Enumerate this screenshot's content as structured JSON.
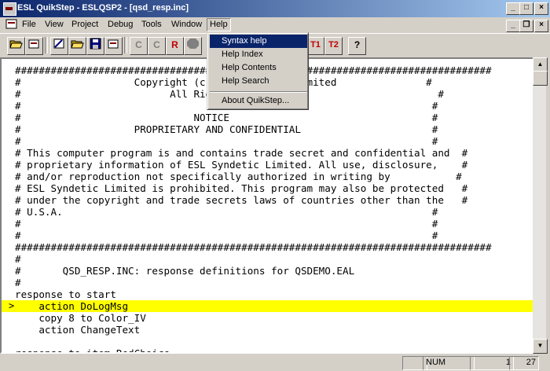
{
  "window": {
    "title": "ESL QuikStep - ESLQSP2 - [qsd_resp.inc]"
  },
  "caption_buttons": {
    "minimize": "_",
    "maximize": "□",
    "close": "×"
  },
  "mdi_buttons": {
    "minimize": "_",
    "restore": "❐",
    "close": "×"
  },
  "menu": [
    "File",
    "View",
    "Project",
    "Debug",
    "Tools",
    "Window",
    "Help"
  ],
  "help_menu": {
    "items": [
      "Syntax help",
      "Help Index",
      "Help Contents",
      "Help Search"
    ],
    "about": "About QuikStep...",
    "selected": "Syntax help"
  },
  "toolbar": {
    "c_label": "C",
    "cr_label": "C",
    "r_label": "R",
    "t1_label": "T1",
    "t2_label": "T2",
    "query_label": "?"
  },
  "editor": {
    "lines": [
      "################################################################################",
      "#                   Copyright (c) ESL Syndetic Limited               #",
      "#                         All Rights Reserved                          #",
      "#                                                                     #",
      "#                             NOTICE                                  #",
      "#                   PROPRIETARY AND CONFIDENTIAL                      #",
      "#                                                                     #",
      "# This computer program is and contains trade secret and confidential and  #",
      "# proprietary information of ESL Syndetic Limited. All use, disclosure,    #",
      "# and/or reproduction not specifically authorized in writing by           #",
      "# ESL Syndetic Limited is prohibited. This program may also be protected   #",
      "# under the copyright and trade secrets laws of countries other than the   #",
      "# U.S.A.                                                              #",
      "#                                                                     #",
      "#                                                                     #",
      "################################################################################",
      "#",
      "#       QSD_RESP.INC: response definitions for QSDEMO.EAL",
      "#",
      "response to start",
      "    action DoLogMsg",
      "    copy 8 to Color_IV",
      "    action ChangeText",
      "",
      "response to item RedChoice"
    ],
    "highlighted_line": 20,
    "marker": ">"
  },
  "status": {
    "num": "NUM",
    "line": "1",
    "col": "27"
  }
}
